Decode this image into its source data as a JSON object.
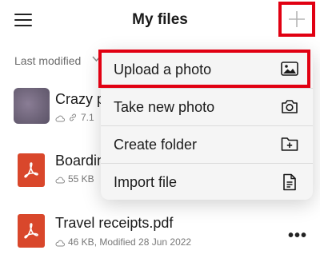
{
  "header": {
    "title": "My files"
  },
  "sort": {
    "label": "Last modified"
  },
  "files": [
    {
      "name": "Crazy p",
      "meta": "7.1"
    },
    {
      "name": "Boardin",
      "meta": "55 KB"
    },
    {
      "name": "Travel receipts.pdf",
      "meta": "46 KB, Modified 28 Jun 2022"
    }
  ],
  "menu": {
    "items": [
      {
        "label": "Upload a photo",
        "icon": "image-icon"
      },
      {
        "label": "Take new photo",
        "icon": "camera-icon"
      },
      {
        "label": "Create folder",
        "icon": "folder-add-icon"
      },
      {
        "label": "Import file",
        "icon": "document-icon"
      }
    ]
  },
  "colors": {
    "highlight": "#e10012",
    "pdf": "#d9472b"
  }
}
